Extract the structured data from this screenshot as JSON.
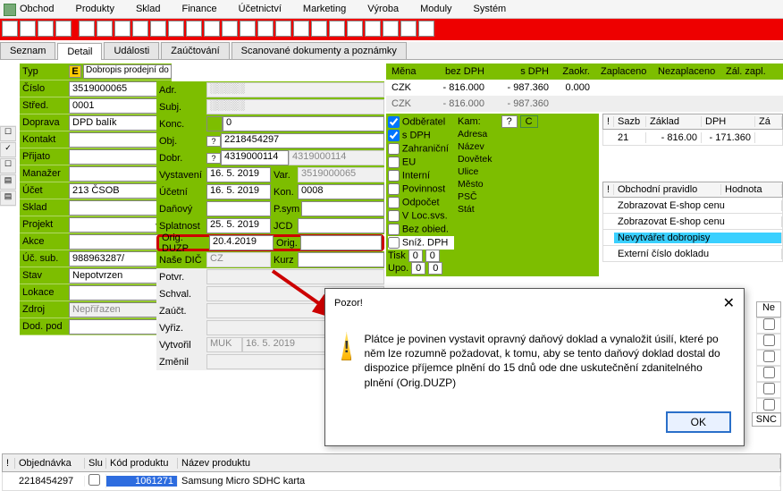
{
  "menu": [
    "Obchod",
    "Produkty",
    "Sklad",
    "Finance",
    "Účetnictví",
    "Marketing",
    "Výroba",
    "Moduly",
    "Systém"
  ],
  "tabs": [
    "Seznam",
    "Detail",
    "Události",
    "Zaúčtování",
    "Scanované dokumenty a poznámky"
  ],
  "active_tab": 1,
  "left": {
    "typ_label": "Typ",
    "typ_flag": "E",
    "typ_text": "Dobropis prodejní do tuzemska,s DPH",
    "cislo_label": "Číslo",
    "cislo": "3519000065",
    "stred_label": "Střed.",
    "stred": "0001",
    "doprava_label": "Doprava",
    "doprava": "DPD balík",
    "kontakt_label": "Kontakt",
    "kontakt": "",
    "prijato_label": "Přijato",
    "prijato": "",
    "manazer_label": "Manažer",
    "manazer": "",
    "ucet_label": "Účet",
    "ucet": "213   ČSOB",
    "sklad_label": "Sklad",
    "sklad": "",
    "projekt_label": "Projekt",
    "projekt": "",
    "akce_label": "Akce",
    "akce": "",
    "ucsub_label": "Úč. sub.",
    "ucsub": "988963287/",
    "stav_label": "Stav",
    "stav": "Nepotvrzen",
    "lokace_label": "Lokace",
    "lokace": "",
    "zdroj_label": "Zdroj",
    "zdroj": "Nepřiřazen",
    "dodpod_label": "Dod. pod",
    "dodpod": ""
  },
  "mid": {
    "adr": "Adr.",
    "subj": "Subj.",
    "konc": "Konc.",
    "obj": "Obj.",
    "dobr": "Dobr.",
    "obj_val": "2218454297",
    "dobr_val": "4319000114",
    "dobr_val2": "4319000114",
    "vystaveni": "Vystavení",
    "vystaveni_val": "16. 5. 2019",
    "ucetni": "Účetní",
    "ucetni_val": "16. 5. 2019",
    "danovy": "Daňový",
    "danovy_val": "",
    "splatnost": "Splatnost",
    "splatnost_val": "25. 5. 2019",
    "orig_duzp": "Orig. DUZP",
    "orig_duzp_val": "20.4.2019",
    "nasedic": "Naše DIČ",
    "nasedic_val": "CZ",
    "potvr": "Potvr.",
    "schval": "Schval.",
    "zauct": "Zaúčt.",
    "vyriz": "Vyřiz.",
    "vytvoril": "Vytvořil",
    "vytvoril_val": "MUK",
    "vytvoril_val2": "16. 5. 2019",
    "zmenil": "Změnil",
    "var": "Var.",
    "var_val": "3519000065",
    "kon": "Kon.",
    "kon_val": "0008",
    "psym": "P.sym",
    "jcd": "JCD",
    "orig": "Orig.",
    "kurz": "Kurz"
  },
  "money": {
    "headers": [
      "Měna",
      "bez DPH",
      "s DPH",
      "Zaokr.",
      "Zaplaceno",
      "Nezaplaceno",
      "Zál. zapl."
    ],
    "row1": [
      "CZK",
      "- 816.000",
      "- 987.360",
      "0.000",
      "",
      "",
      ""
    ],
    "row2": [
      "CZK",
      "- 816.000",
      "- 987.360",
      "",
      "",
      "",
      ""
    ]
  },
  "odb": {
    "odberatel": "Odběratel",
    "sdph": "s DPH",
    "zahranicni": "Zahraniční",
    "eu": "EU",
    "interni": "Interní",
    "povinnost": "Povinnost",
    "odpocet": "Odpočet",
    "vlocsvs": "V Loc.svs.",
    "bezobied": "Bez obied.",
    "snizdph": "Sníž. DPH",
    "kam": "Kam:",
    "adresa": "Adresa",
    "nazev": "Název",
    "dovetek": "Dovětek",
    "ulice": "Ulice",
    "mesto": "Město",
    "psc": "PSČ",
    "stat": "Stát",
    "tisk": "Tisk",
    "tisk1": "0",
    "tisk2": "0",
    "upo": "Upo.",
    "upo1": "0",
    "upo2": "0",
    "upo3": "",
    "q": "?",
    "c": "C"
  },
  "dph_table": {
    "headers": [
      "!",
      "Sazb",
      "Základ",
      "DPH",
      "Zá"
    ],
    "rows": [
      [
        "",
        "21",
        "- 816.00",
        "- 171.360",
        ""
      ]
    ]
  },
  "rules": {
    "headers": [
      "!",
      "Obchodní pravidlo",
      "Hodnota"
    ],
    "rows": [
      "Zobrazovat E-shop cenu",
      "Zobrazovat E-shop cenu",
      "Nevytvářet dobropisy",
      "Externí číslo dokladu"
    ],
    "checks": [
      "",
      "",
      "",
      "",
      "",
      "",
      ""
    ],
    "ne": "Ne",
    "snc": "SNC"
  },
  "bottom": {
    "headers": [
      "!",
      "Objednávka",
      "Slu",
      "Kód produktu",
      "Název produktu"
    ],
    "row": [
      "",
      "2218454297",
      "",
      "1061271",
      "Samsung Micro SDHC karta"
    ]
  },
  "dialog": {
    "title": "Pozor!",
    "msg": "Plátce je povinen vystavit opravný daňový doklad a vynaložit úsilí, které po něm lze rozumně požadovat, k tomu, aby se tento daňový doklad dostal do dispozice příjemce plnění do 15 dnů ode dne uskutečnění zdanitelného plnění (Orig.DUZP)",
    "ok": "OK"
  }
}
